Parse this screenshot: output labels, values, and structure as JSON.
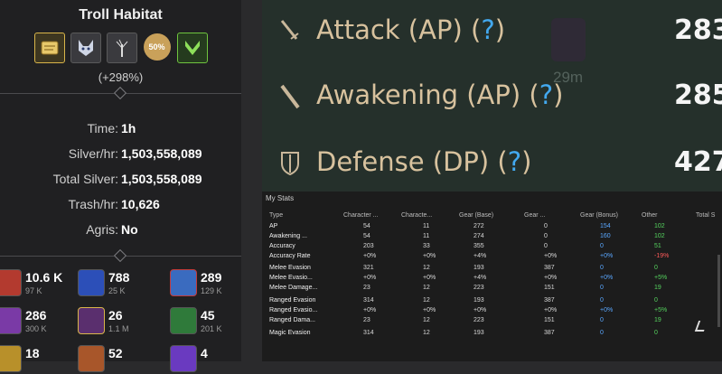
{
  "left_panel": {
    "title": "Troll Habitat",
    "buff_50_label": "50%",
    "bonus_percent": "(+298%)",
    "stats": [
      {
        "label": "Time:",
        "value": "1h"
      },
      {
        "label": "Silver/hr:",
        "value": "1,503,558,089"
      },
      {
        "label": "Total Silver:",
        "value": "1,503,558,089"
      },
      {
        "label": "Trash/hr:",
        "value": "10,626"
      },
      {
        "label": "Agris:",
        "value": "No"
      }
    ],
    "materials": [
      {
        "qty": "10.6 K",
        "sub": "97 K",
        "icon": "red-crystal-icon",
        "color": "#b33a2f"
      },
      {
        "qty": "788",
        "sub": "25 K",
        "icon": "blue-rune-icon",
        "color": "#2c4fb8"
      },
      {
        "qty": "289",
        "sub": "129 K",
        "icon": "blue-shard-icon",
        "color": "#3a6bbf"
      },
      {
        "qty": "286",
        "sub": "300 K",
        "icon": "purple-crystal-icon",
        "color": "#7a3aa6"
      },
      {
        "qty": "26",
        "sub": "1.1 M",
        "icon": "purple-orb-icon",
        "color": "#5a2f6e"
      },
      {
        "qty": "45",
        "sub": "201 K",
        "icon": "green-leaf-icon",
        "color": "#2f7a3a"
      },
      {
        "qty": "18",
        "sub": "",
        "icon": "gold-coin-icon",
        "color": "#b8902a"
      },
      {
        "qty": "52",
        "sub": "",
        "icon": "orange-orb-icon",
        "color": "#a8562a"
      },
      {
        "qty": "4",
        "sub": "",
        "icon": "violet-gem-icon",
        "color": "#6a3ac0"
      }
    ]
  },
  "stats_top": [
    {
      "label": "Attack (AP)",
      "help": "?",
      "value": "283",
      "icon": "sword-icon"
    },
    {
      "label": "Awakening (AP)",
      "help": "?",
      "value": "285",
      "icon": "blade-icon"
    },
    {
      "label": "Defense (DP)",
      "help": "?",
      "value": "427",
      "icon": "shield-icon"
    }
  ],
  "background_label": "29m",
  "my_stats": {
    "title": "My Stats",
    "columns": [
      "Type",
      "Character ...",
      "Characte...",
      "Gear (Base)",
      "Gear ...",
      "Gear (Bonus)",
      "Other",
      "Total S"
    ],
    "rows": [
      [
        "AP",
        "54",
        "11",
        "272",
        "0",
        "154",
        "102"
      ],
      [
        "Awakening ...",
        "54",
        "11",
        "274",
        "0",
        "160",
        "102"
      ],
      [
        "Accuracy",
        "203",
        "33",
        "355",
        "0",
        "0",
        "51"
      ],
      [
        "Accuracy Rate",
        "+0%",
        "+0%",
        "+4%",
        "+0%",
        "+0%",
        "-19%"
      ],
      [
        "Melee Evasion",
        "321",
        "12",
        "193",
        "387",
        "0",
        "0"
      ],
      [
        "Melee Evasio...",
        "+0%",
        "+0%",
        "+4%",
        "+0%",
        "+0%",
        "+5%"
      ],
      [
        "Melee Damage...",
        "23",
        "12",
        "223",
        "151",
        "0",
        "19"
      ],
      [
        "Ranged Evasion",
        "314",
        "12",
        "193",
        "387",
        "0",
        "0"
      ],
      [
        "Ranged Evasio...",
        "+0%",
        "+0%",
        "+0%",
        "+0%",
        "+0%",
        "+5%"
      ],
      [
        "Ranged Dama...",
        "23",
        "12",
        "223",
        "151",
        "0",
        "19"
      ],
      [
        "Magic Evasion",
        "314",
        "12",
        "193",
        "387",
        "0",
        "0"
      ]
    ]
  }
}
